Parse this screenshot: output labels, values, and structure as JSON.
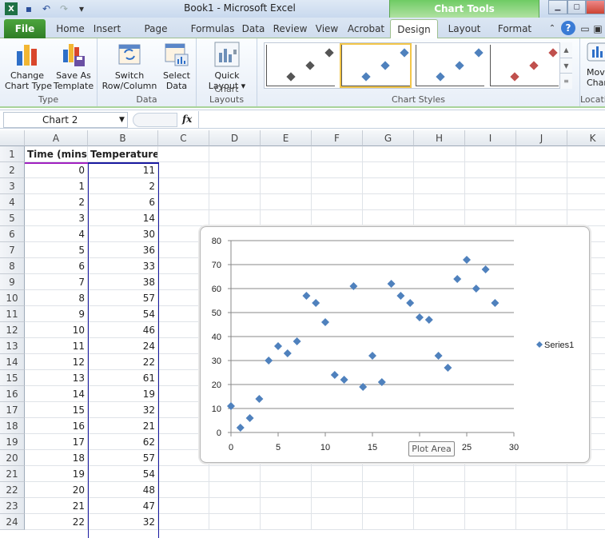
{
  "window": {
    "title": "Book1  -  Microsoft Excel",
    "context_tab_group": "Chart Tools"
  },
  "qat": {
    "icons": [
      "excel-logo-icon",
      "save-icon",
      "undo-icon",
      "redo-icon",
      "customize-qat-icon"
    ]
  },
  "tabs": [
    "File",
    "Home",
    "Insert",
    "Page Layout",
    "Formulas",
    "Data",
    "Review",
    "View",
    "Acrobat",
    "Design",
    "Layout",
    "Format"
  ],
  "active_tab": "Design",
  "ribbon": {
    "groups": [
      {
        "label": "Type",
        "buttons": [
          "Change\nChart Type",
          "Save As\nTemplate"
        ]
      },
      {
        "label": "Data",
        "buttons": [
          "Switch\nRow/Column",
          "Select\nData"
        ]
      },
      {
        "label": "Chart Layouts",
        "buttons": [
          "Quick\nLayout ▾"
        ]
      },
      {
        "label": "Chart Styles"
      },
      {
        "label": "Locati",
        "buttons": [
          "Mov\nChar"
        ]
      }
    ],
    "style_colors": [
      "#555555",
      "#4f81bd",
      "#4f81bd",
      "#c0504d"
    ],
    "selected_style": 1
  },
  "formula_bar": {
    "name_box": "Chart 2",
    "fx_label": "fx",
    "formula": ""
  },
  "columns": [
    "A",
    "B",
    "C",
    "D",
    "E",
    "F",
    "G",
    "H",
    "I",
    "J",
    "K"
  ],
  "sheet": {
    "headers": [
      "Time (mins)",
      "Temperature"
    ],
    "rows": [
      [
        0,
        11
      ],
      [
        1,
        2
      ],
      [
        2,
        6
      ],
      [
        3,
        14
      ],
      [
        4,
        30
      ],
      [
        5,
        36
      ],
      [
        6,
        33
      ],
      [
        7,
        38
      ],
      [
        8,
        57
      ],
      [
        9,
        54
      ],
      [
        10,
        46
      ],
      [
        11,
        24
      ],
      [
        12,
        22
      ],
      [
        13,
        61
      ],
      [
        14,
        19
      ],
      [
        15,
        32
      ],
      [
        16,
        21
      ],
      [
        17,
        62
      ],
      [
        18,
        57
      ],
      [
        19,
        54
      ],
      [
        20,
        48
      ],
      [
        21,
        47
      ],
      [
        22,
        32
      ]
    ]
  },
  "tooltip": "Plot Area",
  "chart_data": {
    "type": "scatter",
    "title": "",
    "xlabel": "",
    "ylabel": "",
    "xlim": [
      0,
      30
    ],
    "ylim": [
      0,
      80
    ],
    "xticks": [
      0,
      5,
      10,
      15,
      20,
      25,
      30
    ],
    "yticks": [
      0,
      10,
      20,
      30,
      40,
      50,
      60,
      70,
      80
    ],
    "grid": "horizontal",
    "legend": "right",
    "marker_color": "#4f81bd",
    "series": [
      {
        "name": "Series1",
        "x": [
          0,
          1,
          2,
          3,
          4,
          5,
          6,
          7,
          8,
          9,
          10,
          11,
          12,
          13,
          14,
          15,
          16,
          17,
          18,
          19,
          20,
          21,
          22,
          23,
          24,
          25,
          26,
          27,
          28
        ],
        "y": [
          11,
          2,
          6,
          14,
          30,
          36,
          33,
          38,
          57,
          54,
          46,
          24,
          22,
          61,
          19,
          32,
          21,
          62,
          57,
          54,
          48,
          47,
          32,
          27,
          64,
          72,
          60,
          68,
          54
        ]
      }
    ]
  }
}
